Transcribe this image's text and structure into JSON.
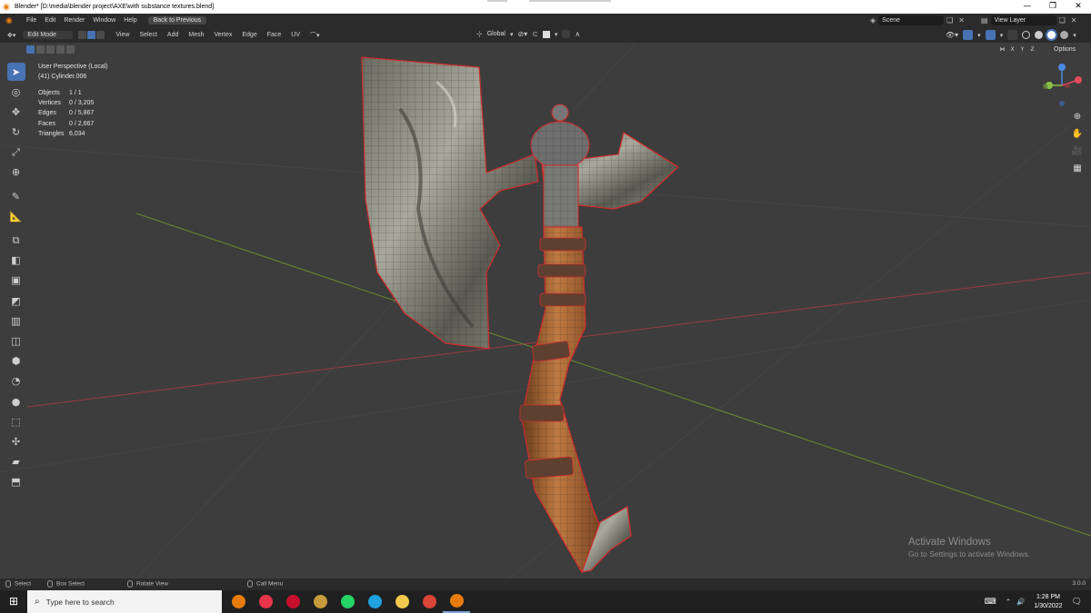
{
  "window": {
    "title": "Blender* [D:\\media\\blender project\\AXE\\with substance textures.blend]",
    "controls": [
      "—",
      "❐",
      "✕"
    ]
  },
  "topbar": {
    "menus": [
      "File",
      "Edit",
      "Render",
      "Window",
      "Help"
    ],
    "back_button": "Back to Previous",
    "scene_label": "Scene",
    "view_layer_label": "View Layer"
  },
  "viewport_header": {
    "mode": "Edit Mode",
    "menus": [
      "View",
      "Select",
      "Add",
      "Mesh",
      "Vertex",
      "Edge",
      "Face",
      "UV"
    ],
    "orientation": "Global",
    "options_label": "Options",
    "axis_buttons": [
      "X",
      "Y",
      "Z"
    ]
  },
  "overlay": {
    "view_name": "User Perspective (Local)",
    "object_name": "(41) Cylinder.006",
    "stats": [
      {
        "label": "Objects",
        "value": "1 / 1"
      },
      {
        "label": "Vertices",
        "value": "0 / 3,205"
      },
      {
        "label": "Edges",
        "value": "0 / 5,867"
      },
      {
        "label": "Faces",
        "value": "0 / 2,667"
      },
      {
        "label": "Triangles",
        "value": "6,034"
      }
    ]
  },
  "toolbar": {
    "tools": [
      {
        "name": "select-box-tool",
        "glyph": "➤"
      },
      {
        "name": "cursor-tool",
        "glyph": "◎"
      },
      {
        "name": "move-tool",
        "glyph": "✥"
      },
      {
        "name": "rotate-tool",
        "glyph": "↻"
      },
      {
        "name": "scale-tool",
        "glyph": "⤢"
      },
      {
        "name": "transform-tool",
        "glyph": "⊕"
      },
      {
        "name": "annotate-tool",
        "glyph": "✎"
      },
      {
        "name": "measure-tool",
        "glyph": "📐"
      },
      {
        "name": "add-cube-tool",
        "glyph": "⧉"
      },
      {
        "name": "extrude-tool",
        "glyph": "◧"
      },
      {
        "name": "inset-tool",
        "glyph": "▣"
      },
      {
        "name": "bevel-tool",
        "glyph": "◩"
      },
      {
        "name": "loop-cut-tool",
        "glyph": "▥"
      },
      {
        "name": "knife-tool",
        "glyph": "◫"
      },
      {
        "name": "poly-build-tool",
        "glyph": "⬢"
      },
      {
        "name": "spin-tool",
        "glyph": "◔"
      },
      {
        "name": "smooth-tool",
        "glyph": "●"
      },
      {
        "name": "edge-slide-tool",
        "glyph": "⬚"
      },
      {
        "name": "shrink-fatten-tool",
        "glyph": "✣"
      },
      {
        "name": "shear-tool",
        "glyph": "▰"
      },
      {
        "name": "rip-region-tool",
        "glyph": "⬒"
      }
    ]
  },
  "watermark": {
    "title": "Activate Windows",
    "subtitle": "Go to Settings to activate Windows."
  },
  "statusbar": {
    "select": "Select",
    "box_select": "Box Select",
    "rotate_view": "Rotate View",
    "call_menu": "Call Menu",
    "version": "3.0.0"
  },
  "taskbar": {
    "search_placeholder": "Type here to search",
    "apps": [
      {
        "name": "blender-app",
        "color": "#e87d0d"
      },
      {
        "name": "substance-painter-app",
        "color": "#e8344b"
      },
      {
        "name": "davinci-resolve-app",
        "color": "#c8102e"
      },
      {
        "name": "league-of-legends-app",
        "color": "#c89b3c"
      },
      {
        "name": "whatsapp-app",
        "color": "#25d366"
      },
      {
        "name": "edge-browser-app",
        "color": "#1fa3e0"
      },
      {
        "name": "file-explorer-app",
        "color": "#f2c94c"
      },
      {
        "name": "chrome-browser-app",
        "color": "#db4437"
      },
      {
        "name": "blender-app-running",
        "color": "#e87d0d"
      }
    ],
    "time": "1:28 PM",
    "date": "1/30/2022"
  },
  "colors": {
    "accent": "#4772b3",
    "x_axis": "#e24b5b",
    "y_axis": "#8bc34a",
    "z_axis": "#4a8be0"
  }
}
